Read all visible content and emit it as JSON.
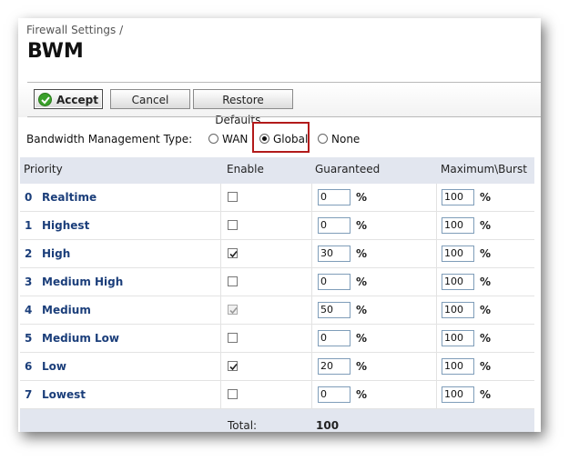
{
  "header": {
    "breadcrumb": "Firewall Settings /",
    "title": "BWM"
  },
  "toolbar": {
    "accept_label": "Accept",
    "cancel_label": "Cancel",
    "restore_label": "Restore Defaults..."
  },
  "bandwidth_type": {
    "label": "Bandwidth Management Type:",
    "options": [
      {
        "label": "WAN",
        "selected": false
      },
      {
        "label": "Global",
        "selected": true
      },
      {
        "label": "None",
        "selected": false
      }
    ]
  },
  "table": {
    "headers": {
      "priority": "Priority",
      "enable": "Enable",
      "guaranteed": "Guaranteed",
      "maximum": "Maximum\\Burst"
    },
    "percent_symbol": "%",
    "rows": [
      {
        "num": "0",
        "name": "Realtime",
        "enabled": false,
        "disabled": false,
        "guaranteed": "0",
        "maximum": "100"
      },
      {
        "num": "1",
        "name": "Highest",
        "enabled": false,
        "disabled": false,
        "guaranteed": "0",
        "maximum": "100"
      },
      {
        "num": "2",
        "name": "High",
        "enabled": true,
        "disabled": false,
        "guaranteed": "30",
        "maximum": "100"
      },
      {
        "num": "3",
        "name": "Medium High",
        "enabled": false,
        "disabled": false,
        "guaranteed": "0",
        "maximum": "100"
      },
      {
        "num": "4",
        "name": "Medium",
        "enabled": true,
        "disabled": true,
        "guaranteed": "50",
        "maximum": "100"
      },
      {
        "num": "5",
        "name": "Medium Low",
        "enabled": false,
        "disabled": false,
        "guaranteed": "0",
        "maximum": "100"
      },
      {
        "num": "6",
        "name": "Low",
        "enabled": true,
        "disabled": false,
        "guaranteed": "20",
        "maximum": "100"
      },
      {
        "num": "7",
        "name": "Lowest",
        "enabled": false,
        "disabled": false,
        "guaranteed": "0",
        "maximum": "100"
      }
    ],
    "total_label": "Total:",
    "total_value": "100"
  },
  "colors": {
    "highlight": "#b21a1a",
    "link": "#1b3e7a",
    "header_bg": "#e2e6ef"
  }
}
